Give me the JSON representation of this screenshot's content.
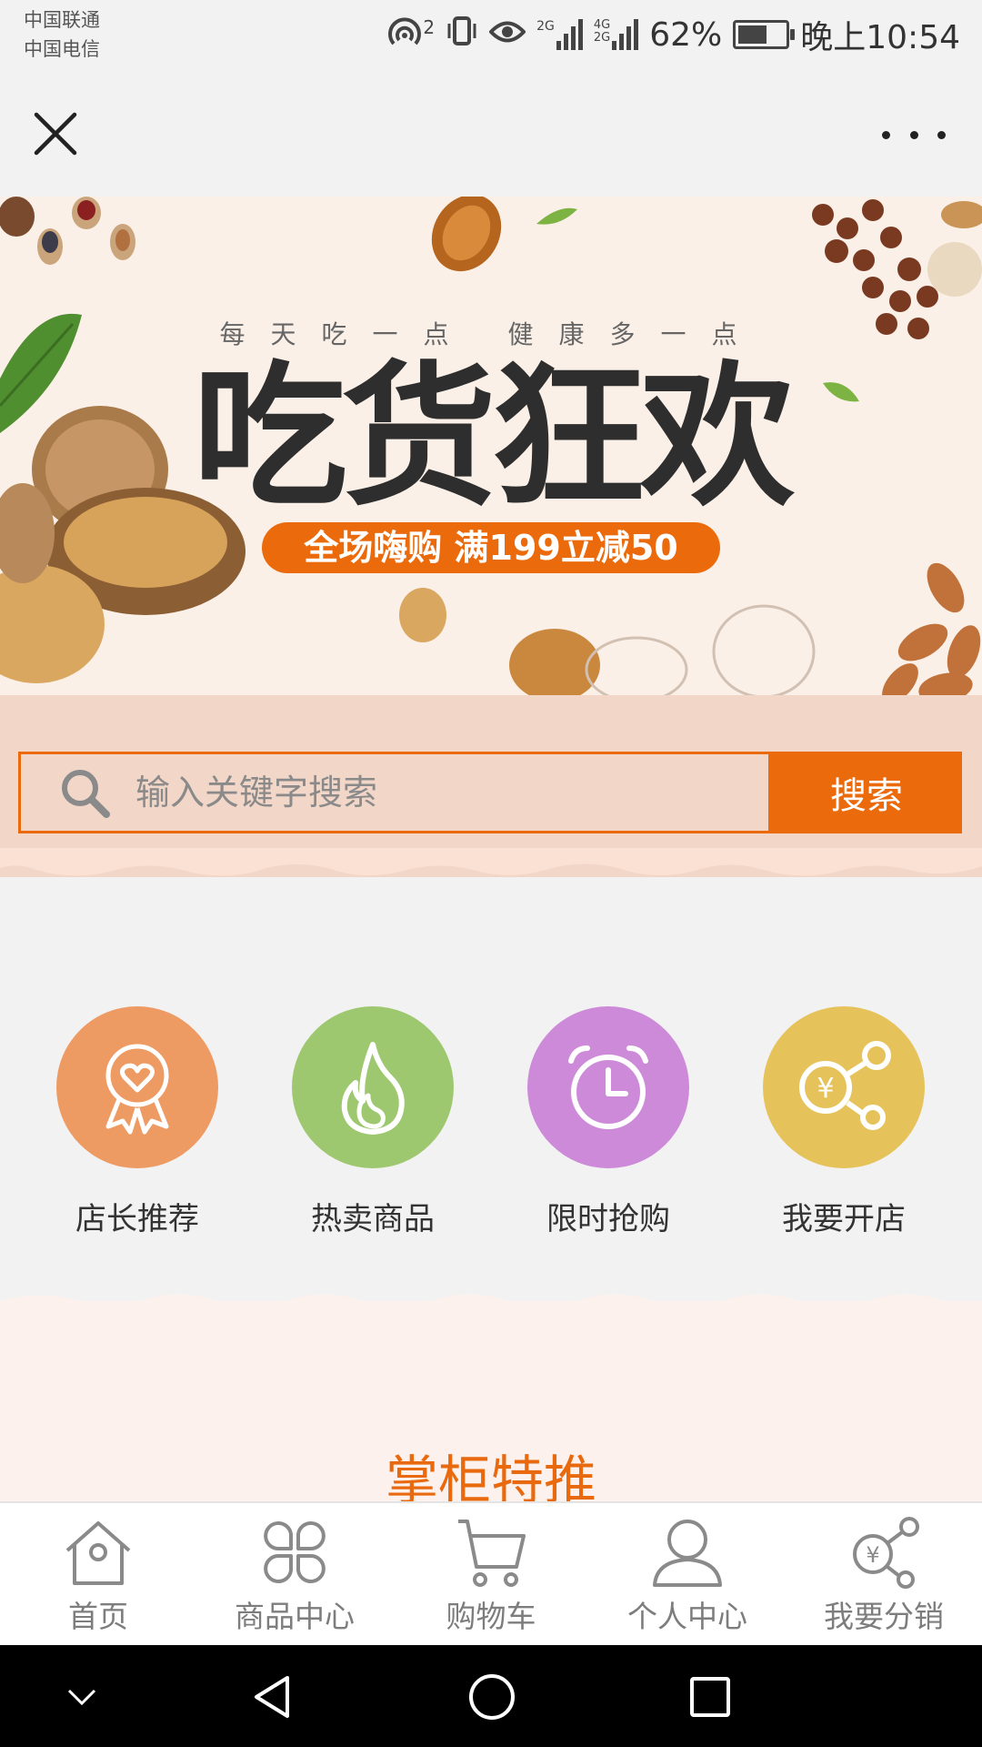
{
  "status_bar": {
    "carrier_1": "中国联通",
    "carrier_2": "中国电信",
    "hotspot_sup": "2",
    "net_1": "2G",
    "net_2": "4G\n2G",
    "battery": "62%",
    "battery_level": 0.62,
    "time": "晚上10:54"
  },
  "banner": {
    "subtitle": "每天吃一点 健康多一点",
    "title": "吃货狂欢",
    "promo": "全场嗨购 满199立减50"
  },
  "search": {
    "placeholder": "输入关键字搜索",
    "button": "搜索"
  },
  "quick_links": [
    {
      "label": "店长推荐",
      "icon": "badge-heart-icon",
      "color": "#ee9a63"
    },
    {
      "label": "热卖商品",
      "icon": "flame-icon",
      "color": "#9ec870"
    },
    {
      "label": "限时抢购",
      "icon": "alarm-clock-icon",
      "color": "#cd8ad8"
    },
    {
      "label": "我要开店",
      "icon": "share-yen-icon",
      "color": "#e6c35a"
    }
  ],
  "featured": {
    "title": "掌柜特推"
  },
  "tabs": [
    {
      "label": "首页",
      "icon": "home-icon"
    },
    {
      "label": "商品中心",
      "icon": "grid-icon"
    },
    {
      "label": "购物车",
      "icon": "cart-icon"
    },
    {
      "label": "个人中心",
      "icon": "user-icon"
    },
    {
      "label": "我要分销",
      "icon": "share-yen-icon"
    }
  ],
  "colors": {
    "accent": "#ea6a0c",
    "search_bg": "#f2d6c8",
    "banner_bg": "#fbf0e8"
  }
}
